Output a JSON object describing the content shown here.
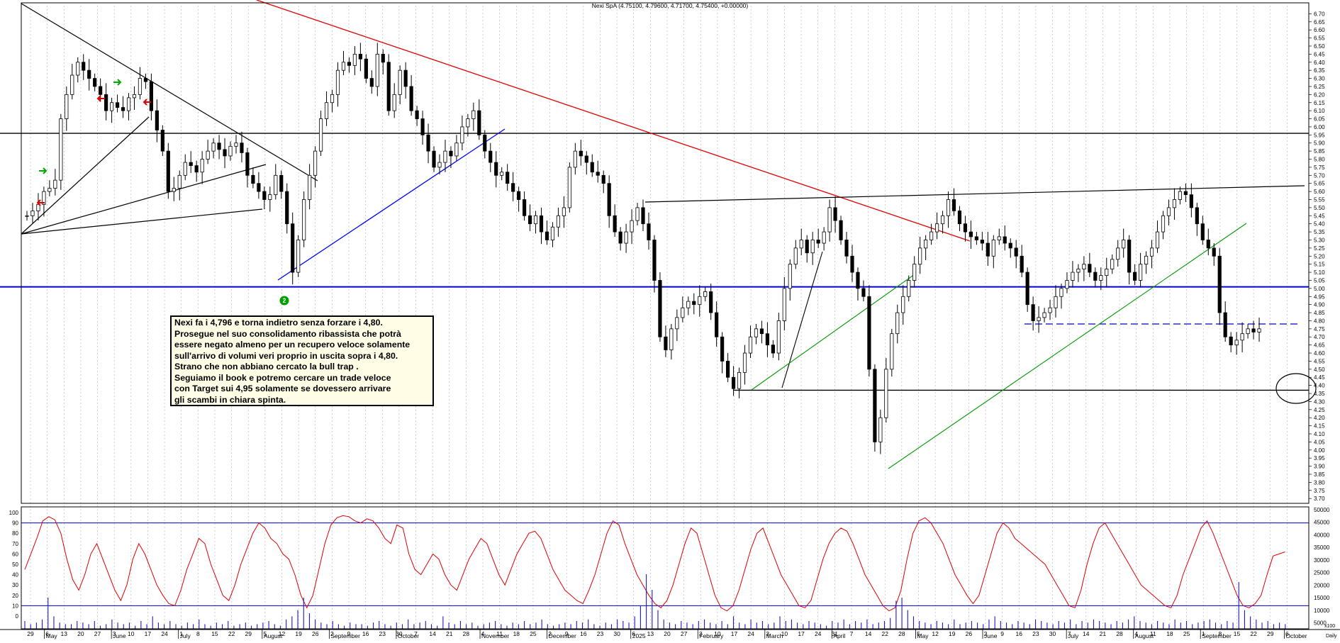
{
  "chart_data": [
    {
      "type": "candlestick",
      "title": "Nexi SpA (4.75100, 4.79600, 4.71700, 4.75400, +0.00000)",
      "ylim": [
        3.67,
        6.75
      ],
      "y_ticks": [
        "6.70",
        "6.65",
        "6.60",
        "6.55",
        "6.50",
        "6.45",
        "6.40",
        "6.35",
        "6.30",
        "6.25",
        "6.20",
        "6.15",
        "6.10",
        "6.05",
        "6.00",
        "5.95",
        "5.90",
        "5.85",
        "5.80",
        "5.75",
        "5.70",
        "5.65",
        "5.60",
        "5.55",
        "5.50",
        "5.45",
        "5.40",
        "5.35",
        "5.30",
        "5.25",
        "5.20",
        "5.15",
        "5.10",
        "5.05",
        "5.00",
        "4.95",
        "4.90",
        "4.85",
        "4.80",
        "4.75",
        "4.70",
        "4.65",
        "4.60",
        "4.55",
        "4.50",
        "4.45",
        "4.40",
        "4.35",
        "4.30",
        "4.25",
        "4.20",
        "4.15",
        "4.10",
        "4.05",
        "4.00",
        "3.95",
        "3.90",
        "3.85",
        "3.80",
        "3.75",
        "3.70"
      ],
      "horizontal_levels": [
        {
          "value": 5.96,
          "color": "#000000"
        },
        {
          "value": 5.01,
          "color": "#0000cc"
        },
        {
          "value": 4.37,
          "color": "#000000"
        },
        {
          "value": 4.78,
          "color": "#0000cc",
          "style": "dashed"
        }
      ],
      "close_series": [
        5.45,
        5.48,
        5.52,
        5.6,
        5.62,
        5.67,
        6.05,
        6.2,
        6.32,
        6.4,
        6.35,
        6.3,
        6.25,
        6.2,
        6.1,
        6.15,
        6.12,
        6.1,
        6.18,
        6.2,
        6.3,
        6.28,
        6.1,
        5.98,
        5.85,
        5.6,
        5.62,
        5.7,
        5.78,
        5.76,
        5.72,
        5.8,
        5.85,
        5.9,
        5.86,
        5.82,
        5.88,
        5.9,
        5.84,
        5.7,
        5.65,
        5.6,
        5.55,
        5.58,
        5.7,
        5.6,
        5.4,
        5.1,
        5.3,
        5.55,
        5.7,
        5.85,
        6.05,
        6.15,
        6.2,
        6.35,
        6.4,
        6.38,
        6.45,
        6.42,
        6.3,
        6.25,
        6.45,
        6.4,
        6.1,
        6.2,
        6.35,
        6.25,
        6.1,
        6.05,
        5.95,
        5.85,
        5.75,
        5.78,
        5.85,
        5.82,
        5.9,
        6.0,
        6.05,
        6.1,
        5.95,
        5.85,
        5.78,
        5.7,
        5.72,
        5.65,
        5.6,
        5.55,
        5.45,
        5.4,
        5.45,
        5.35,
        5.3,
        5.38,
        5.45,
        5.5,
        5.75,
        5.85,
        5.82,
        5.78,
        5.72,
        5.7,
        5.65,
        5.45,
        5.35,
        5.28,
        5.35,
        5.42,
        5.5,
        5.4,
        5.3,
        5.05,
        4.7,
        4.62,
        4.75,
        4.82,
        4.88,
        4.92,
        4.9,
        4.95,
        4.98,
        4.85,
        4.7,
        4.55,
        4.45,
        4.38,
        4.48,
        4.6,
        4.7,
        4.75,
        4.72,
        4.65,
        4.6,
        4.8,
        5.0,
        5.15,
        5.25,
        5.3,
        5.22,
        5.3,
        5.28,
        5.35,
        5.5,
        5.42,
        5.3,
        5.2,
        5.1,
        5.0,
        4.95,
        4.5,
        4.05,
        4.2,
        4.5,
        4.72,
        4.85,
        4.95,
        5.05,
        5.15,
        5.25,
        5.3,
        5.35,
        5.4,
        5.45,
        5.55,
        5.48,
        5.4,
        5.35,
        5.32,
        5.3,
        5.28,
        5.2,
        5.3,
        5.32,
        5.28,
        5.25,
        5.2,
        5.1,
        4.9,
        4.8,
        4.82,
        4.85,
        4.88,
        4.95,
        5.0,
        5.05,
        5.1,
        5.12,
        5.15,
        5.1,
        5.05,
        5.08,
        5.12,
        5.18,
        5.25,
        5.3,
        5.1,
        5.05,
        5.15,
        5.2,
        5.25,
        5.35,
        5.45,
        5.5,
        5.55,
        5.6,
        5.58,
        5.5,
        5.4,
        5.3,
        5.25,
        5.2,
        4.85,
        4.7,
        4.65,
        4.68,
        4.72,
        4.75,
        4.73,
        4.75
      ]
    },
    {
      "type": "line+bar",
      "ylim_left": [
        0,
        100
      ],
      "y_ticks_left": [
        "100",
        "90",
        "80",
        "70",
        "60",
        "50",
        "40",
        "30",
        "20",
        "10",
        "0"
      ],
      "y_ticks_right": [
        "50000",
        "45000",
        "40000",
        "35000",
        "30000",
        "25000",
        "20000",
        "15000",
        "10000",
        "5000"
      ],
      "right_unit": "x100",
      "horizontal_levels": [
        {
          "value": 90,
          "color": "#0000cc"
        },
        {
          "value": 10,
          "color": "#0000cc"
        }
      ],
      "oscillator_series": [
        45,
        60,
        75,
        92,
        96,
        93,
        80,
        55,
        35,
        25,
        40,
        60,
        70,
        55,
        40,
        25,
        15,
        30,
        55,
        70,
        60,
        45,
        30,
        20,
        12,
        10,
        25,
        45,
        60,
        75,
        70,
        50,
        35,
        20,
        15,
        30,
        50,
        65,
        80,
        90,
        85,
        75,
        70,
        60,
        55,
        40,
        20,
        8,
        20,
        45,
        70,
        88,
        95,
        97,
        96,
        92,
        90,
        94,
        92,
        85,
        75,
        70,
        88,
        85,
        60,
        45,
        40,
        50,
        60,
        55,
        40,
        30,
        25,
        40,
        55,
        65,
        75,
        70,
        55,
        40,
        30,
        45,
        60,
        70,
        80,
        82,
        75,
        60,
        45,
        35,
        25,
        20,
        15,
        12,
        25,
        40,
        60,
        80,
        92,
        88,
        70,
        55,
        40,
        30,
        20,
        12,
        8,
        15,
        30,
        50,
        70,
        85,
        80,
        60,
        40,
        20,
        8,
        5,
        10,
        25,
        45,
        65,
        80,
        85,
        70,
        55,
        40,
        30,
        20,
        10,
        8,
        15,
        35,
        55,
        70,
        80,
        85,
        82,
        70,
        55,
        40,
        30,
        20,
        10,
        5,
        8,
        25,
        55,
        80,
        92,
        95,
        90,
        80,
        70,
        55,
        40,
        30,
        20,
        12,
        20,
        40,
        60,
        80,
        90,
        85,
        75,
        70,
        65,
        60,
        55,
        50,
        40,
        30,
        20,
        10,
        8,
        25,
        50,
        70,
        85,
        90,
        80,
        70,
        60,
        50,
        40,
        30,
        25,
        20,
        15,
        10,
        8,
        20,
        40,
        55,
        70,
        85,
        92,
        80,
        65,
        50,
        35,
        20,
        10,
        8,
        12,
        20,
        40,
        58,
        60,
        62
      ],
      "volume_series": [
        5,
        3,
        4,
        6,
        20,
        8,
        4,
        3,
        3,
        5,
        4,
        3,
        5,
        2,
        3,
        6,
        4,
        3,
        4,
        2,
        5,
        3,
        8,
        4,
        3,
        5,
        3,
        2,
        4,
        3,
        6,
        3,
        2,
        4,
        3,
        5,
        2,
        3,
        4,
        2,
        3,
        4,
        5,
        3,
        2,
        6,
        8,
        12,
        20,
        10,
        6,
        4,
        3,
        5,
        3,
        2,
        4,
        3,
        3,
        2,
        4,
        5,
        3,
        2,
        4,
        3,
        6,
        3,
        4,
        5,
        3,
        2,
        8,
        4,
        3,
        5,
        3,
        4,
        2,
        3,
        4,
        5,
        3,
        2,
        4,
        3,
        5,
        3,
        4,
        6,
        3,
        2,
        3,
        4,
        3,
        5,
        4,
        6,
        3,
        2,
        4,
        3,
        6,
        5,
        4,
        8,
        15,
        35,
        25,
        12,
        6,
        4,
        3,
        5,
        4,
        3,
        5,
        6,
        4,
        3,
        5,
        3,
        8,
        4,
        3,
        6,
        4,
        5,
        3,
        4,
        8,
        5,
        6,
        4,
        3,
        5,
        4,
        3,
        2,
        5,
        4,
        6,
        3,
        5,
        4,
        6,
        3,
        4,
        5,
        7,
        18,
        20,
        12,
        8,
        5,
        4,
        3,
        5,
        4,
        3,
        6,
        3,
        4,
        5,
        4,
        3,
        6,
        8,
        5,
        4,
        3,
        5,
        4,
        3,
        6,
        5,
        4,
        3,
        5,
        4,
        6,
        3,
        5,
        4,
        6,
        5,
        4,
        3,
        5,
        4,
        6,
        8,
        5,
        4,
        3,
        5,
        4,
        3,
        6,
        4,
        5,
        3,
        4,
        5,
        6,
        4,
        3,
        5,
        4,
        30,
        12,
        8,
        6,
        4,
        5,
        3,
        4,
        3
      ]
    }
  ],
  "x_axis": {
    "days": [
      "29",
      "6",
      "13",
      "20",
      "27",
      "3",
      "10",
      "17",
      "24",
      "1",
      "8",
      "15",
      "22",
      "29",
      "5",
      "12",
      "19",
      "26",
      "2",
      "9",
      "16",
      "23",
      "30",
      "7",
      "14",
      "21",
      "28",
      "4",
      "11",
      "18",
      "25",
      "2",
      "9",
      "16",
      "23",
      "30",
      "6",
      "13",
      "20",
      "27",
      "3",
      "10",
      "17",
      "24",
      "3",
      "10",
      "17",
      "24",
      "31",
      "7",
      "14",
      "22",
      "28",
      "5",
      "12",
      "19",
      "26",
      "2",
      "9",
      "16",
      "23",
      "30",
      "7",
      "14",
      "21",
      "28",
      "4",
      "11",
      "18",
      "25",
      "1",
      "8",
      "15",
      "22",
      "29",
      "6"
    ],
    "months": [
      "May",
      "June",
      "July",
      "August",
      "September",
      "October",
      "November",
      "December",
      "2025",
      "February",
      "March",
      "April",
      "May",
      "June",
      "July",
      "August",
      "September",
      "October"
    ],
    "corner_label": "Daily"
  },
  "annotations": {
    "circle_label": "2",
    "note_lines": [
      "Nexi fa i 4,796 e torna indietro senza forzare i 4,80.",
      "Prosegue nel suo consolidamento ribassista che potrà",
      "essere negato almeno per un recupero veloce solamente",
      "sull'arrivo di volumi veri proprio in uscita sopra i 4,80.",
      "Strano che non abbiano cercato la bull trap .",
      "Seguiamo il book e potremo cercare un trade veloce",
      "con Target sui 4,95 solamente se dovessero arrivare",
      "gli scambi in chiara spinta."
    ]
  },
  "colors": {
    "up_candle": "#ffffff",
    "down_candle": "#000000",
    "oscillator": "#e00000",
    "volume": "#1a1acc",
    "trend_red": "#e00000",
    "trend_blue": "#0000ff",
    "trend_green": "#009900",
    "arrow_green": "#00aa00",
    "arrow_red": "#dd0000",
    "badge": "#00a000"
  }
}
